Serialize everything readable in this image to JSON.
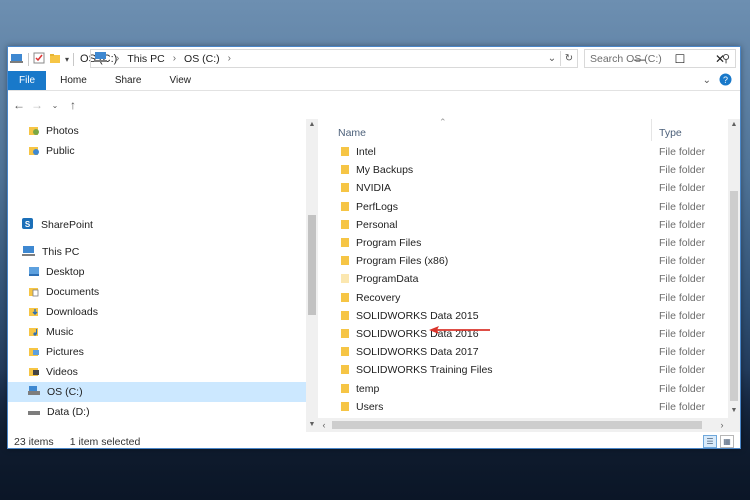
{
  "window": {
    "title": "OS (C:)",
    "caption": {
      "minimize": "—",
      "maximize": "☐",
      "close": "✕"
    }
  },
  "ribbon": {
    "tabs": [
      "File",
      "Home",
      "Share",
      "View"
    ]
  },
  "address": {
    "crumbs": [
      "This PC",
      "OS (C:)"
    ],
    "search_placeholder": "Search OS (C:)"
  },
  "navpane": {
    "items": [
      {
        "label": "Photos",
        "icon": "photos-folder-icon"
      },
      {
        "label": "Public",
        "icon": "public-folder-icon"
      },
      {
        "label": "SharePoint",
        "icon": "sharepoint-icon"
      },
      {
        "label": "This PC",
        "icon": "computer-icon"
      },
      {
        "label": "Desktop",
        "icon": "desktop-folder-icon"
      },
      {
        "label": "Documents",
        "icon": "documents-folder-icon"
      },
      {
        "label": "Downloads",
        "icon": "downloads-folder-icon"
      },
      {
        "label": "Music",
        "icon": "music-folder-icon"
      },
      {
        "label": "Pictures",
        "icon": "pictures-folder-icon"
      },
      {
        "label": "Videos",
        "icon": "videos-folder-icon"
      },
      {
        "label": "OS (C:)",
        "icon": "drive-icon"
      },
      {
        "label": "Data (D:)",
        "icon": "drive-icon"
      }
    ]
  },
  "filelist": {
    "columns": {
      "name": "Name",
      "type": "Type"
    },
    "rows": [
      {
        "name": "Intel",
        "type": "File folder"
      },
      {
        "name": "My Backups",
        "type": "File folder"
      },
      {
        "name": "NVIDIA",
        "type": "File folder"
      },
      {
        "name": "PerfLogs",
        "type": "File folder"
      },
      {
        "name": "Personal",
        "type": "File folder"
      },
      {
        "name": "Program Files",
        "type": "File folder"
      },
      {
        "name": "Program Files (x86)",
        "type": "File folder"
      },
      {
        "name": "ProgramData",
        "type": "File folder",
        "hidden": true
      },
      {
        "name": "Recovery",
        "type": "File folder"
      },
      {
        "name": "SOLIDWORKS Data 2015",
        "type": "File folder"
      },
      {
        "name": "SOLIDWORKS Data 2016",
        "type": "File folder"
      },
      {
        "name": "SOLIDWORKS Data 2017",
        "type": "File folder"
      },
      {
        "name": "SOLIDWORKS Training Files",
        "type": "File folder"
      },
      {
        "name": "temp",
        "type": "File folder"
      },
      {
        "name": "Users",
        "type": "File folder"
      }
    ]
  },
  "status": {
    "item_count": "23 items",
    "selection": "1 item selected"
  },
  "colors": {
    "accent": "#1979ca",
    "folder": "#f6c545",
    "folder_hidden": "#fbe7b0",
    "selection": "#cce8ff",
    "annotation": "#d9342b"
  }
}
